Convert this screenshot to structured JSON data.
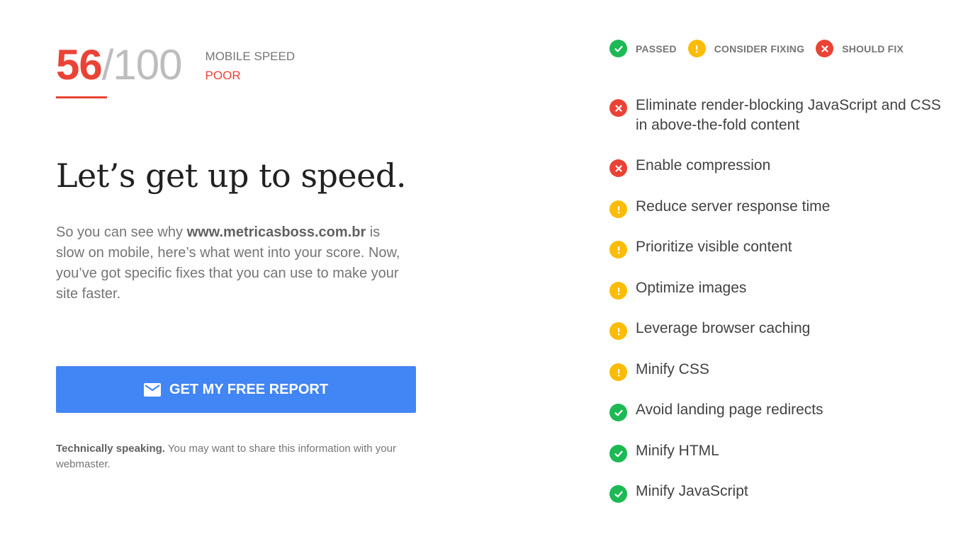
{
  "score": {
    "value": "56",
    "separator": "/",
    "max": "100",
    "label": "MOBILE SPEED",
    "rating": "POOR"
  },
  "headline": "Let’s get up to speed.",
  "description": {
    "before": "So you can see why ",
    "site": "www.metricasboss.com.br",
    "after": " is slow on mobile, here’s what went into your score. Now, you’ve got specific fixes that you can use to make your site faster."
  },
  "cta": {
    "label": "GET MY FREE REPORT",
    "icon": "mail-icon"
  },
  "footnote": {
    "bold": "Technically speaking.",
    "text": " You may want to share this information with your webmaster."
  },
  "legend": [
    {
      "label": "PASSED",
      "status": "pass"
    },
    {
      "label": "CONSIDER FIXING",
      "status": "warn"
    },
    {
      "label": "SHOULD FIX",
      "status": "fail"
    }
  ],
  "rules": [
    {
      "label": "Eliminate render-blocking JavaScript and CSS in above-the-fold content",
      "status": "fail"
    },
    {
      "label": "Enable compression",
      "status": "fail"
    },
    {
      "label": "Reduce server response time",
      "status": "warn"
    },
    {
      "label": "Prioritize visible content",
      "status": "warn"
    },
    {
      "label": "Optimize images",
      "status": "warn"
    },
    {
      "label": "Leverage browser caching",
      "status": "warn"
    },
    {
      "label": "Minify CSS",
      "status": "warn"
    },
    {
      "label": "Avoid landing page redirects",
      "status": "pass"
    },
    {
      "label": "Minify HTML",
      "status": "pass"
    },
    {
      "label": "Minify JavaScript",
      "status": "pass"
    }
  ],
  "colors": {
    "fail": "#ea4335",
    "warn": "#fbbc05",
    "pass": "#1db954",
    "accent": "#4285f4"
  }
}
